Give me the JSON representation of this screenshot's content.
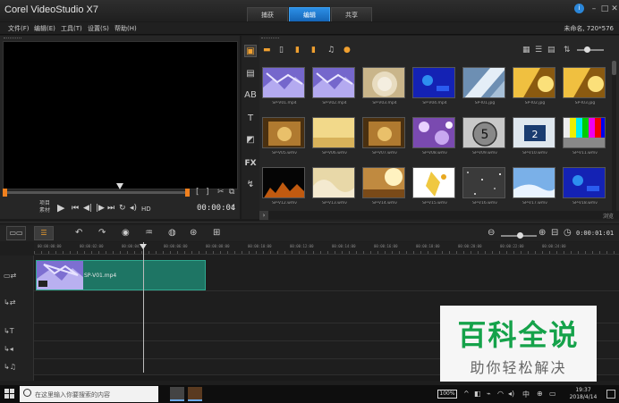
{
  "app": {
    "title": "Corel VideoStudio X7",
    "tabs": [
      {
        "label": "捕获",
        "active": false
      },
      {
        "label": "编辑",
        "active": true
      },
      {
        "label": "共享",
        "active": false
      }
    ],
    "window_controls": [
      "minimize-icon",
      "maximize-icon",
      "close-icon"
    ]
  },
  "menu": {
    "items": [
      "文件(F)",
      "编辑(E)",
      "工具(T)",
      "设置(S)",
      "帮助(H)"
    ],
    "project_info": "未命名, 720*576"
  },
  "preview": {
    "mode_labels": [
      "项目",
      "素材"
    ],
    "timecode": "00:00:04",
    "hd_label": "HD",
    "clip_buttons": [
      "[",
      "]",
      "✂"
    ]
  },
  "library": {
    "tools": [
      "media-icon",
      "instant-project-icon",
      "transition-icon",
      "title-icon",
      "graphic-icon",
      "filter-icon",
      "path-icon"
    ],
    "thumbnails": [
      {
        "caption": "SP-V01.mp4",
        "style": "purple"
      },
      {
        "caption": "SP-V02.mp4",
        "style": "purple"
      },
      {
        "caption": "SP-V03.mp4",
        "style": "swirl"
      },
      {
        "caption": "SP-V04.mp4",
        "style": "blue"
      },
      {
        "caption": "SP-I01.jpg",
        "style": "silver"
      },
      {
        "caption": "SP-I02.jpg",
        "style": "gold"
      },
      {
        "caption": "SP-I03.jpg",
        "style": "gold"
      },
      {
        "caption": "SP-V05.wmv",
        "style": "sepia"
      },
      {
        "caption": "SP-V06.wmv",
        "style": "sand"
      },
      {
        "caption": "SP-V07.wmv",
        "style": "sepia"
      },
      {
        "caption": "SP-V08.wmv",
        "style": "bokeh"
      },
      {
        "caption": "SP-V09.wmv",
        "style": "countdown"
      },
      {
        "caption": "SP-V10.wmv",
        "style": "countdown2"
      },
      {
        "caption": "SP-V11.wmv",
        "style": "testcard"
      },
      {
        "caption": "SP-V12.wmv",
        "style": "fire"
      },
      {
        "caption": "SP-V13.wmv",
        "style": "wave"
      },
      {
        "caption": "SP-V14.wmv",
        "style": "light"
      },
      {
        "caption": "SP-V15.wmv",
        "style": "splash"
      },
      {
        "caption": "SP-V16.wmv",
        "style": "noise"
      },
      {
        "caption": "SP-V17.wmv",
        "style": "sky"
      },
      {
        "caption": "SP-V18.wmv",
        "style": "blue"
      }
    ],
    "bottom_label": "浏览"
  },
  "timeline": {
    "timecode": "0:00:01:01",
    "ruler": [
      "00:00:00:00",
      "00:00:02:00",
      "00:00:04:00",
      "00:00:06:00",
      "00:00:08:00",
      "00:00:10:00",
      "00:00:12:00",
      "00:00:14:00",
      "00:00:16:00",
      "00:00:18:00",
      "00:00:20:00",
      "00:00:22:00",
      "00:00:24:00"
    ],
    "clip": {
      "name": "SP-V01.mp4"
    }
  },
  "watermark": {
    "title": "百科全说",
    "subtitle": "助你轻松解决"
  },
  "taskbar": {
    "search_placeholder": "在这里输入你要搜索的内容",
    "battery": "100%",
    "time": "19:37",
    "date": "2018/4/14",
    "ime": "中"
  }
}
